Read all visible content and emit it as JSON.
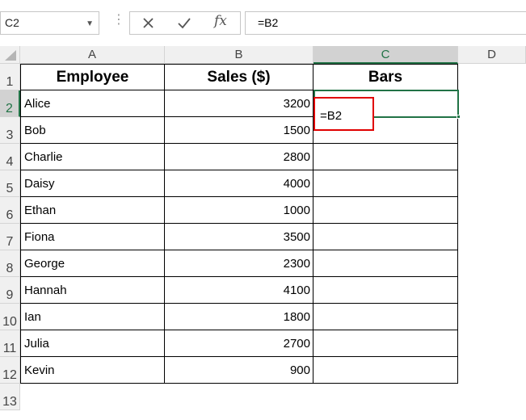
{
  "formula_bar": {
    "name_box": "C2",
    "formula": "=B2"
  },
  "columns": [
    "A",
    "B",
    "C",
    "D"
  ],
  "rows": [
    "1",
    "2",
    "3",
    "4",
    "5",
    "6",
    "7",
    "8",
    "9",
    "10",
    "11",
    "12",
    "13"
  ],
  "table": {
    "headers": [
      "Employee",
      "Sales ($)",
      "Bars"
    ],
    "data": [
      {
        "name": "Alice",
        "sales": "3200",
        "bar": ""
      },
      {
        "name": "Bob",
        "sales": "1500",
        "bar": ""
      },
      {
        "name": "Charlie",
        "sales": "2800",
        "bar": ""
      },
      {
        "name": "Daisy",
        "sales": "4000",
        "bar": ""
      },
      {
        "name": "Ethan",
        "sales": "1000",
        "bar": ""
      },
      {
        "name": "Fiona",
        "sales": "3500",
        "bar": ""
      },
      {
        "name": "George",
        "sales": "2300",
        "bar": ""
      },
      {
        "name": "Hannah",
        "sales": "4100",
        "bar": ""
      },
      {
        "name": "Ian",
        "sales": "1800",
        "bar": ""
      },
      {
        "name": "Julia",
        "sales": "2700",
        "bar": ""
      },
      {
        "name": "Kevin",
        "sales": "900",
        "bar": ""
      }
    ]
  },
  "active_cell": {
    "ref": "C2",
    "editing_text": "=B2"
  },
  "colors": {
    "selection": "#217346",
    "highlight": "#e00000"
  }
}
